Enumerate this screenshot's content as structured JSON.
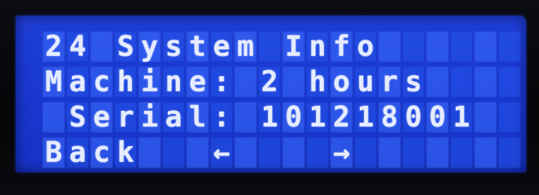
{
  "lcd": {
    "columns": 20,
    "rows": [
      {
        "text": "24 System Info"
      },
      {
        "text": "Machine: 2 hours"
      },
      {
        "text": " Serial: 101218001"
      },
      {
        "text": "Back   ←    →"
      }
    ]
  },
  "colors": {
    "background": "#1a38d2",
    "text": "#e6ecff",
    "bezel": "#06070b"
  }
}
